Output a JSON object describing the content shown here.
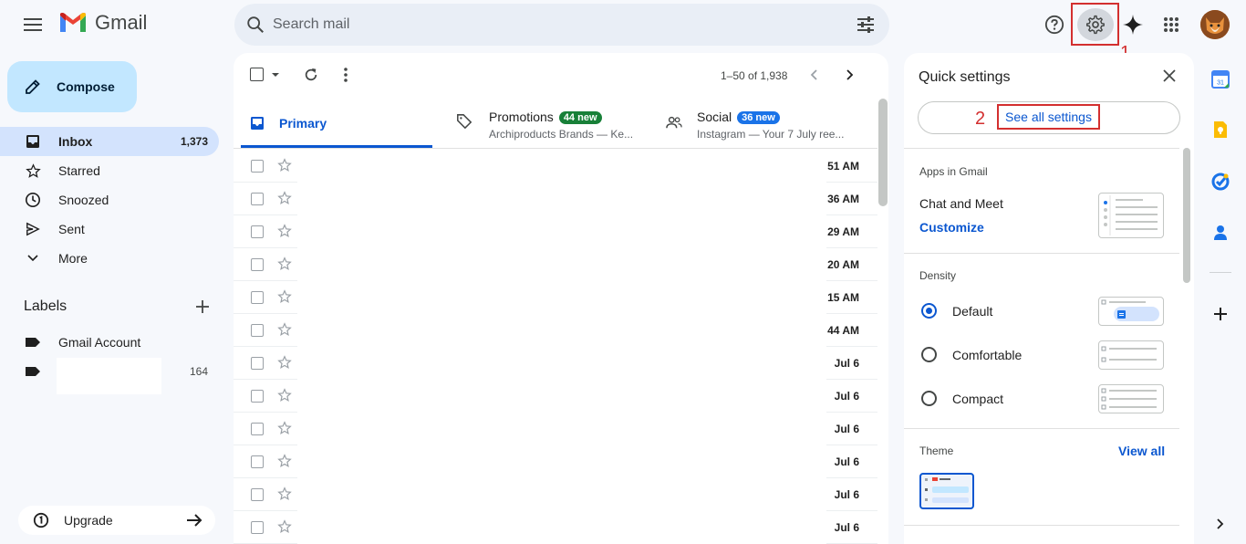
{
  "app": {
    "name": "Gmail"
  },
  "search": {
    "placeholder": "Search mail"
  },
  "annotations": {
    "step1": "1",
    "step2": "2"
  },
  "compose": {
    "label": "Compose"
  },
  "nav": [
    {
      "label": "Inbox",
      "count": "1,373",
      "icon": "inbox-icon"
    },
    {
      "label": "Starred",
      "count": "",
      "icon": "star-icon"
    },
    {
      "label": "Snoozed",
      "count": "",
      "icon": "clock-icon"
    },
    {
      "label": "Sent",
      "count": "",
      "icon": "send-icon"
    },
    {
      "label": "More",
      "count": "",
      "icon": "chevron-down-icon"
    }
  ],
  "labels": {
    "title": "Labels",
    "items": [
      {
        "label": "Gmail Account",
        "count": ""
      },
      {
        "label": "",
        "count": "164"
      }
    ]
  },
  "upgrade": {
    "label": "Upgrade"
  },
  "toolbar": {
    "pager": "1–50 of 1,938"
  },
  "tabs": {
    "primary": {
      "label": "Primary"
    },
    "promotions": {
      "label": "Promotions",
      "badge": "44 new",
      "sub": "Archiproducts Brands — Ke..."
    },
    "social": {
      "label": "Social",
      "badge": "36 new",
      "sub": "Instagram — Your 7 July ree..."
    }
  },
  "rows": [
    {
      "date": "51 AM"
    },
    {
      "date": "36 AM"
    },
    {
      "date": "29 AM"
    },
    {
      "date": "20 AM"
    },
    {
      "date": "15 AM"
    },
    {
      "date": "44 AM"
    },
    {
      "date": "Jul 6"
    },
    {
      "date": "Jul 6"
    },
    {
      "date": "Jul 6"
    },
    {
      "date": "Jul 6"
    },
    {
      "date": "Jul 6"
    },
    {
      "date": "Jul 6"
    }
  ],
  "quick_settings": {
    "title": "Quick settings",
    "see_all": "See all settings",
    "apps_heading": "Apps in Gmail",
    "chat_meet": "Chat and Meet",
    "customize": "Customize",
    "density_heading": "Density",
    "density_options": [
      "Default",
      "Comfortable",
      "Compact"
    ],
    "theme_heading": "Theme",
    "view_all": "View all"
  },
  "colors": {
    "accent": "#0b57d0",
    "annotation": "#d32f2f",
    "promotions_badge": "#188038",
    "social_badge": "#1a73e8"
  }
}
